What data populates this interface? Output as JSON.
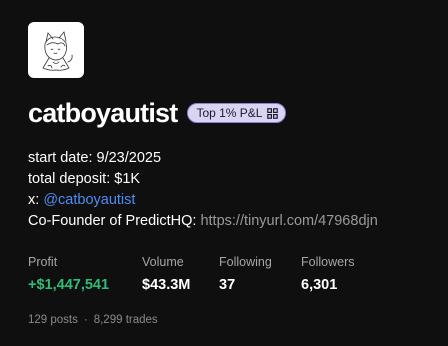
{
  "profile": {
    "username": "catboyautist",
    "badge_label": "Top 1% P&L",
    "badge_icon": "grid-icon",
    "avatar_icon": "catboy-sketch-avatar"
  },
  "bio": {
    "start_date": "start date: 9/23/2025",
    "total_deposit": "total deposit: $1K",
    "x_prefix": "x: ",
    "x_handle": "@catboyautist",
    "cofounder_prefix": "Co-Founder of PredictHQ: ",
    "cofounder_link": "https://tinyurl.com/47968djn"
  },
  "stats": {
    "profit_label": "Profit",
    "profit_value": "+$1,447,541",
    "volume_label": "Volume",
    "volume_value": "$43.3M",
    "following_label": "Following",
    "following_value": "37",
    "followers_label": "Followers",
    "followers_value": "6,301"
  },
  "footer": {
    "posts": "129 posts",
    "separator": "·",
    "trades": "8,299 trades"
  },
  "colors": {
    "background": "#0f0f0f",
    "profit_green": "#2ebd79",
    "link_blue": "#4f8cf5",
    "badge_bg": "#d9d4f2",
    "badge_border": "#8d80d8"
  }
}
